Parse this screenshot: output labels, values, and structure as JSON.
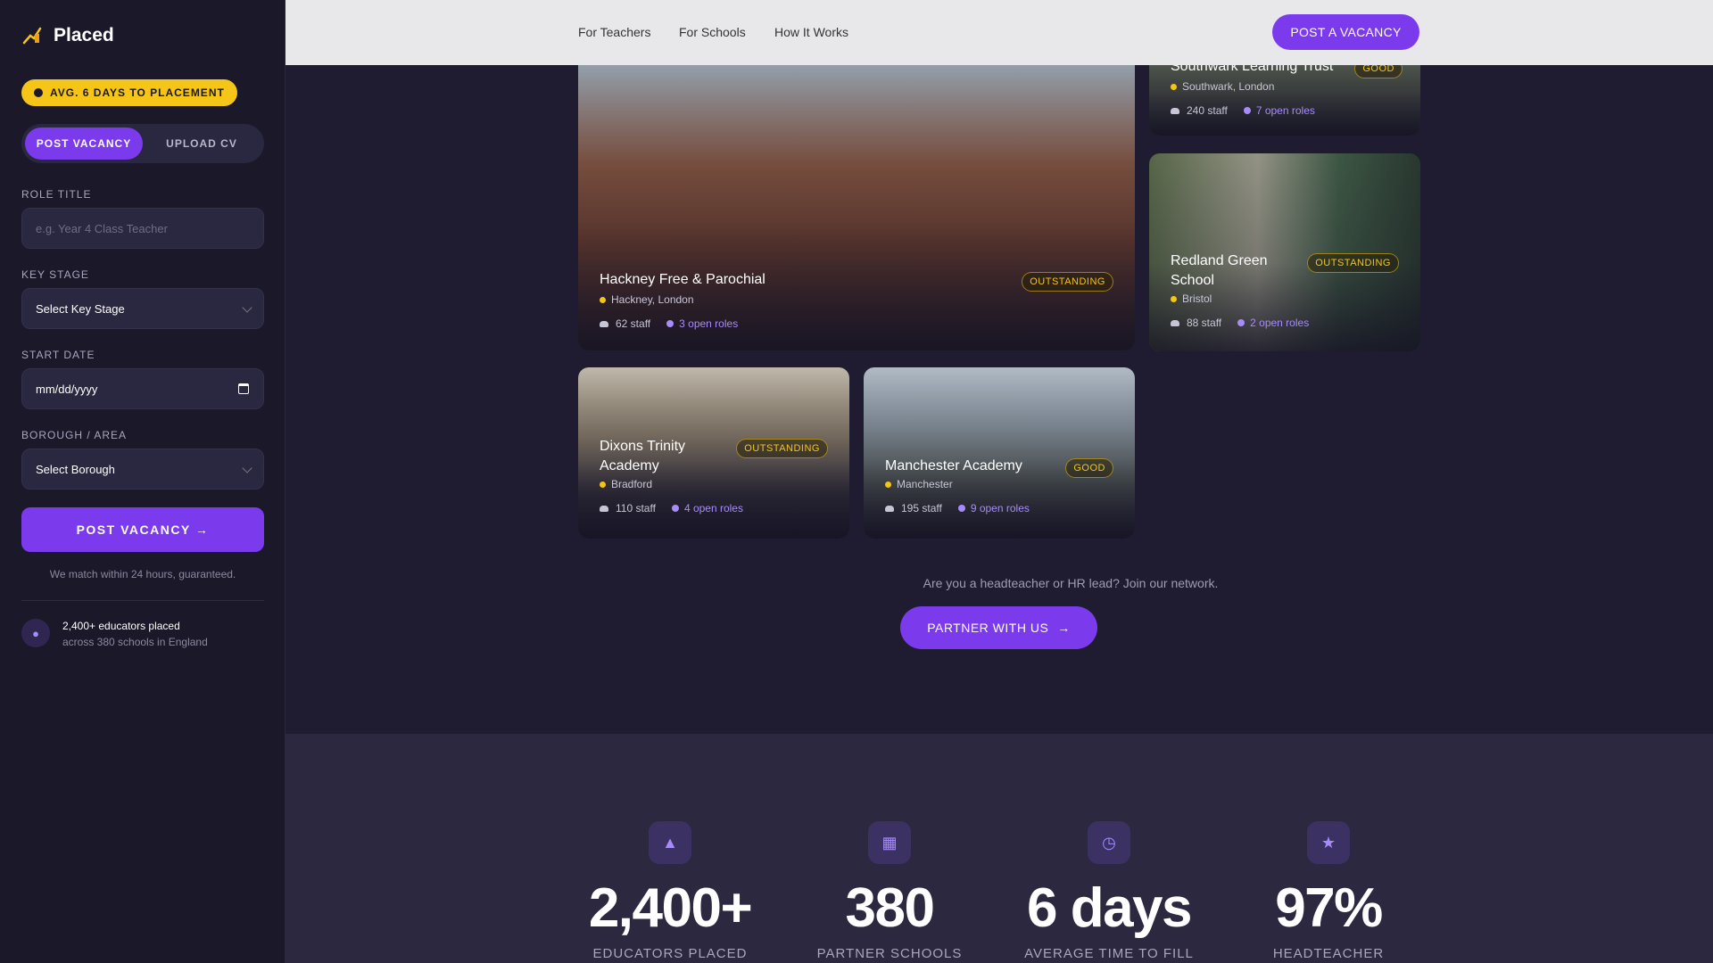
{
  "app": {
    "name": "Placed"
  },
  "sidebar": {
    "badge": "AVG. 6 DAYS TO PLACEMENT",
    "tabs": [
      "POST VACANCY",
      "UPLOAD CV"
    ],
    "fields": {
      "role_title": {
        "label": "ROLE TITLE",
        "placeholder": "e.g. Year 4 Class Teacher"
      },
      "key_stage": {
        "label": "KEY STAGE",
        "value": "Select Key Stage"
      },
      "start_date": {
        "label": "START DATE",
        "value": "mm/dd/yyyy"
      },
      "borough": {
        "label": "BOROUGH / AREA",
        "value": "Select Borough"
      }
    },
    "submit_label": "POST VACANCY →",
    "guarantee": "We match within 24 hours, guaranteed.",
    "social_proof": {
      "title": "2,400+ educators placed",
      "subtitle": "across 380 schools in England"
    }
  },
  "nav": {
    "links": [
      "For Teachers",
      "For Schools",
      "How It Works"
    ],
    "cta": "POST A VACANCY"
  },
  "schools": [
    {
      "name": "Southwark Learning Trust",
      "location": "Southwark, London",
      "staff": "240 staff",
      "roles": "7 open roles",
      "rating": "GOOD"
    },
    {
      "name": "Hackney Free & Parochial",
      "location": "Hackney, London",
      "staff": "62 staff",
      "roles": "3 open roles",
      "rating": "OUTSTANDING"
    },
    {
      "name": "Redland Green School",
      "location": "Bristol",
      "staff": "88 staff",
      "roles": "2 open roles",
      "rating": "OUTSTANDING"
    },
    {
      "name": "Dixons Trinity Academy",
      "location": "Bradford",
      "staff": "110 staff",
      "roles": "4 open roles",
      "rating": "OUTSTANDING"
    },
    {
      "name": "Manchester Academy",
      "location": "Manchester",
      "staff": "195 staff",
      "roles": "9 open roles",
      "rating": "GOOD"
    }
  ],
  "partner": {
    "prompt": "Are you a headteacher or HR lead? Join our network.",
    "button": "PARTNER WITH US"
  },
  "stats": [
    {
      "icon": "graduation-cap-icon",
      "value": "2,400+",
      "label": "EDUCATORS PLACED"
    },
    {
      "icon": "building-icon",
      "value": "380",
      "label": "PARTNER SCHOOLS"
    },
    {
      "icon": "clock-icon",
      "value": "6 days",
      "label": "AVERAGE TIME TO FILL"
    },
    {
      "icon": "star-icon",
      "value": "97%",
      "label": "HEADTEACHER"
    }
  ]
}
